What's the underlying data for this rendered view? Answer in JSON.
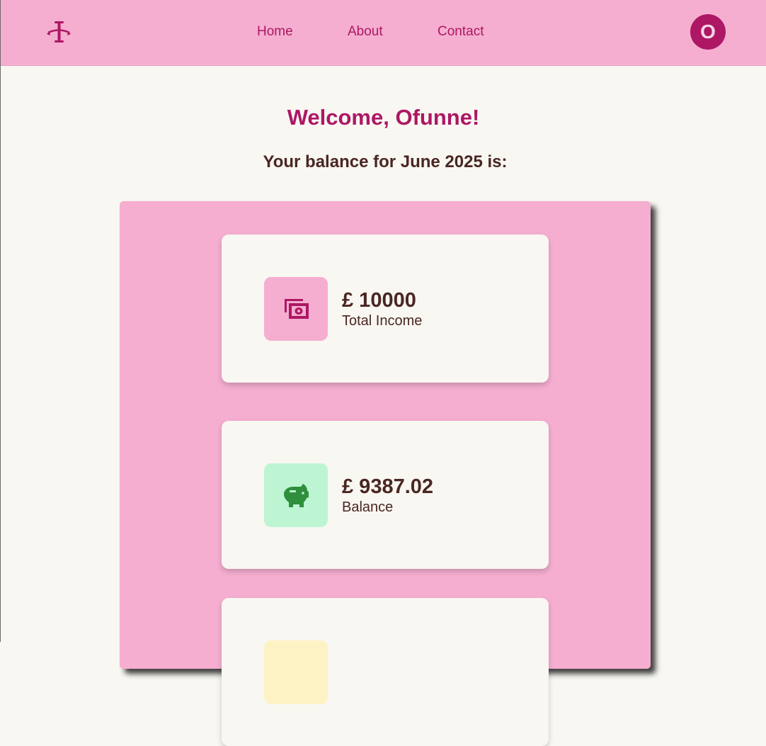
{
  "nav": {
    "logo_icon": "balance-scale-icon",
    "links": [
      "Home",
      "About",
      "Contact"
    ],
    "avatar_initial": "O"
  },
  "welcome": "Welcome, Ofunne!",
  "subtitle": "Your balance for June 2025 is:",
  "cards": [
    {
      "amount": "£ 10000",
      "label": "Total Income",
      "icon": "cash-icon",
      "icon_bg": "#f5aed0",
      "icon_color": "#ad1764"
    },
    {
      "amount": "£ 9387.02",
      "label": "Balance",
      "icon": "piggy-bank-icon",
      "icon_bg": "#bdf5d3",
      "icon_color": "#2f8f3d"
    }
  ],
  "colors": {
    "brand": "#ad1764",
    "nav_bg": "#f5aed0",
    "page_bg": "#f8f7f2",
    "text_dark": "#4a2622"
  }
}
